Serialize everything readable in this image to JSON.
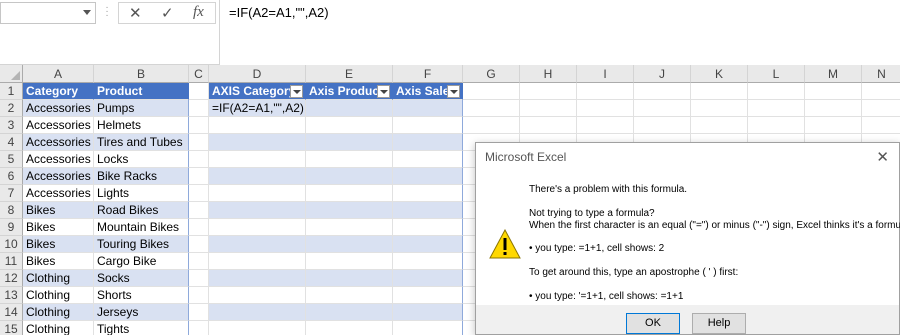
{
  "formula_bar": {
    "name_box": "",
    "cancel_glyph": "✕",
    "enter_glyph": "✓",
    "fx_label": "fx",
    "formula": "=IF(A2=A1,\"\",A2)"
  },
  "columns": [
    "A",
    "B",
    "C",
    "D",
    "E",
    "F",
    "G",
    "H",
    "I",
    "J",
    "K",
    "L",
    "M",
    "N"
  ],
  "rows": [
    "1",
    "2",
    "3",
    "4",
    "5",
    "6",
    "7",
    "8",
    "9",
    "10",
    "11",
    "12",
    "13",
    "14",
    "15"
  ],
  "table_left": {
    "headers": [
      "Category",
      "Product"
    ],
    "data": [
      [
        "Accessories",
        "Pumps"
      ],
      [
        "Accessories",
        "Helmets"
      ],
      [
        "Accessories",
        "Tires and Tubes"
      ],
      [
        "Accessories",
        "Locks"
      ],
      [
        "Accessories",
        "Bike Racks"
      ],
      [
        "Accessories",
        "Lights"
      ],
      [
        "Bikes",
        "Road Bikes"
      ],
      [
        "Bikes",
        "Mountain Bikes"
      ],
      [
        "Bikes",
        "Touring Bikes"
      ],
      [
        "Bikes",
        "Cargo Bike"
      ],
      [
        "Clothing",
        "Socks"
      ],
      [
        "Clothing",
        "Shorts"
      ],
      [
        "Clothing",
        "Jerseys"
      ],
      [
        "Clothing",
        "Tights"
      ]
    ]
  },
  "table_right": {
    "headers": [
      "AXIS Category",
      "Axis Product",
      "Axis Sales"
    ],
    "d2_value": "=IF(A2=A1,\"\",A2)"
  },
  "dialog": {
    "title": "Microsoft Excel",
    "line1": "There's a problem with this formula.",
    "line2": "Not trying to type a formula?",
    "line3": "When the first character is an equal (\"=\") or minus (\"-\") sign, Excel thinks it's a formula:",
    "line4": "• you type:   =1+1, cell shows:   2",
    "line5": "To get around this, type an apostrophe ( ' ) first:",
    "line6": "• you type:   '=1+1, cell shows:   =1+1",
    "ok_label": "OK",
    "help_label": "Help"
  },
  "colors": {
    "table_header": "#4472c4",
    "table_band": "#d9e1f2",
    "excel_green": "#217346"
  }
}
